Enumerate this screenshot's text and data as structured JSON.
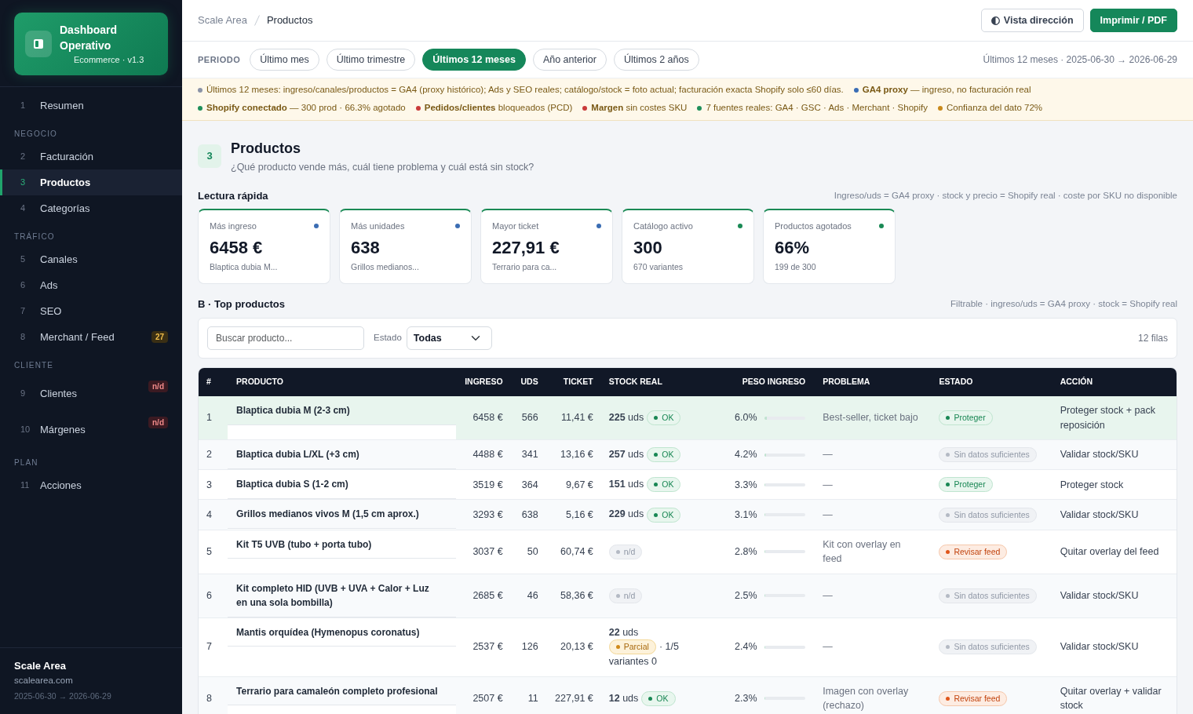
{
  "sidebar": {
    "brand": {
      "title": "Dashboard Operativo",
      "subtitle": "Ecommerce · v1.3"
    },
    "nav": [
      {
        "kind": "item",
        "number": "1",
        "label": "Resumen",
        "selected": false
      },
      {
        "kind": "heading",
        "label": "NEGOCIO"
      },
      {
        "kind": "item",
        "number": "2",
        "label": "Facturación",
        "selected": false
      },
      {
        "kind": "item",
        "number": "3",
        "label": "Productos",
        "selected": true
      },
      {
        "kind": "item",
        "number": "4",
        "label": "Categorías",
        "selected": false
      },
      {
        "kind": "heading",
        "label": "TRÁFICO"
      },
      {
        "kind": "item",
        "number": "5",
        "label": "Canales",
        "selected": false
      },
      {
        "kind": "item",
        "number": "6",
        "label": "Ads",
        "selected": false
      },
      {
        "kind": "item",
        "number": "7",
        "label": "SEO",
        "selected": false
      },
      {
        "kind": "item",
        "number": "8",
        "label": "Merchant / Feed",
        "selected": false,
        "badge": {
          "kind": "warning",
          "text": "27"
        }
      },
      {
        "kind": "heading",
        "label": "CLIENTE"
      },
      {
        "kind": "item",
        "number": "9",
        "label": "Clientes",
        "selected": false,
        "badge": {
          "kind": "danger",
          "text": "n/d"
        }
      },
      {
        "kind": "item",
        "number": "10",
        "label": "Márgenes",
        "selected": false,
        "badge": {
          "kind": "danger",
          "text": "n/d"
        }
      },
      {
        "kind": "heading",
        "label": "PLAN"
      },
      {
        "kind": "item",
        "number": "11",
        "label": "Acciones",
        "selected": false
      }
    ],
    "footer": {
      "name": "Scale Area",
      "site": "scalearea.com",
      "range": "2025-06-30 → 2026-06-29"
    }
  },
  "header": {
    "breadcrumb": [
      "Scale Area",
      "Productos"
    ],
    "buttons": [
      {
        "kind": "view",
        "label": "Vista dirección"
      },
      {
        "kind": "print",
        "label": "Imprimir / PDF"
      }
    ]
  },
  "period": {
    "label": "PERIODO",
    "options": [
      {
        "label": "Último mes",
        "selected": false
      },
      {
        "label": "Último trimestre",
        "selected": false
      },
      {
        "label": "Últimos 12 meses",
        "selected": true
      },
      {
        "label": "Año anterior",
        "selected": false
      },
      {
        "label": "Últimos 2 años",
        "selected": false
      }
    ],
    "range": "Últimos 12 meses · 2025-06-30 → 2026-06-29"
  },
  "notes": [
    [
      {
        "color": "#8b93a7",
        "text": "Últimos 12 meses: ingreso/canales/productos = GA4 (proxy histórico); Ads y SEO reales; catálogo/stock = foto actual; facturación exacta Shopify solo ≤60 días."
      },
      {
        "color": "#3a6db5",
        "text": "**GA4 proxy** — ingreso, no facturación real"
      }
    ],
    [
      {
        "color": "#1f8f5a",
        "text": "**Shopify conectado** — 300 prod · 66.3% agotado"
      },
      {
        "color": "#c93a3a",
        "text": "**Pedidos/clientes** bloqueados (PCD)"
      },
      {
        "color": "#c93a3a",
        "text": "**Margen** sin costes SKU"
      },
      {
        "color": "#1f8f5a",
        "text": "7 fuentes reales: GA4 · GSC · Ads · Merchant · Shopify"
      },
      {
        "color": "#c98a1c",
        "text": "Confianza del dato 72%"
      }
    ]
  ],
  "section": {
    "number": "3",
    "title": "Productos",
    "subtitle": "¿Qué producto vende más, cuál tiene problema y cuál está sin stock?"
  },
  "quick_read": {
    "title": "Lectura rápida",
    "note": "Ingreso/uds = GA4 proxy · stock y precio = Shopify real · coste por SKU no disponible",
    "cards": [
      {
        "label": "Más ingreso",
        "color": "#3b6db3",
        "value": "6458 €",
        "detail": "Blaptica dubia M..."
      },
      {
        "label": "Más unidades",
        "color": "#3b6db3",
        "value": "638",
        "detail": "Grillos medianos..."
      },
      {
        "label": "Mayor ticket",
        "color": "#3b6db3",
        "value": "227,91 €",
        "detail": "Terrario para ca..."
      },
      {
        "label": "Catálogo activo",
        "color": "#1a8a55",
        "value": "300",
        "detail": "670 variantes"
      },
      {
        "label": "Productos agotados",
        "color": "#1a8a55",
        "value": "66%",
        "detail": "199 de 300"
      }
    ]
  },
  "top_products": {
    "title": "B · Top productos",
    "note": "Filtrable · ingreso/uds = GA4 proxy · stock = Shopify real",
    "search": {
      "placeholder": "Buscar producto..."
    },
    "filter": {
      "label": "Estado",
      "value": "Todas"
    },
    "count": "12 filas",
    "table": {
      "columns": [
        "#",
        "PRODUCTO",
        "INGRESO",
        "UDS",
        "TICKET",
        "STOCK REAL",
        "PESO INGRESO",
        "PROBLEMA",
        "ESTADO",
        "ACCIÓN"
      ],
      "rows": [
        {
          "number": "1",
          "product": "Blaptica dubia M (2-3 cm)",
          "revenue": "6458 €",
          "units": "566",
          "ticket": "11,41 €",
          "stock": {
            "kind": "ok",
            "quantity": "**225** uds",
            "badge": "OK"
          },
          "share": "6.0%",
          "level": 0.06,
          "problem": "Best-seller, ticket bajo",
          "status": {
            "kind": "protect",
            "label": "Proteger"
          },
          "action": "Proteger stock + pack reposición",
          "selected": true
        },
        {
          "number": "2",
          "product": "Blaptica dubia L/XL (+3 cm)",
          "revenue": "4488 €",
          "units": "341",
          "ticket": "13,16 €",
          "stock": {
            "kind": "ok",
            "quantity": "**257** uds",
            "badge": "OK"
          },
          "share": "4.2%",
          "level": 0.042,
          "problem": "—",
          "status": {
            "kind": "none",
            "label": "Sin datos suficientes"
          },
          "action": "Validar stock/SKU",
          "selected": false
        },
        {
          "number": "3",
          "product": "Blaptica dubia S (1-2 cm)",
          "revenue": "3519 €",
          "units": "364",
          "ticket": "9,67 €",
          "stock": {
            "kind": "ok",
            "quantity": "**151** uds",
            "badge": "OK"
          },
          "share": "3.3%",
          "level": 0.033,
          "problem": "—",
          "status": {
            "kind": "protect",
            "label": "Proteger"
          },
          "action": "Proteger stock",
          "selected": false
        },
        {
          "number": "4",
          "product": "Grillos medianos vivos M (1,5 cm aprox.)",
          "revenue": "3293 €",
          "units": "638",
          "ticket": "5,16 €",
          "stock": {
            "kind": "ok",
            "quantity": "**229** uds",
            "badge": "OK"
          },
          "share": "3.1%",
          "level": 0.031,
          "problem": "—",
          "status": {
            "kind": "none",
            "label": "Sin datos suficientes"
          },
          "action": "Validar stock/SKU",
          "selected": false
        },
        {
          "number": "5",
          "product": "Kit T5 UVB (tubo + porta tubo)",
          "revenue": "3037 €",
          "units": "50",
          "ticket": "60,74 €",
          "stock": {
            "kind": "na",
            "badge": "n/d"
          },
          "share": "2.8%",
          "level": 0.028,
          "problem": "Kit con overlay en feed",
          "status": {
            "kind": "review",
            "label": "Revisar feed"
          },
          "action": "Quitar overlay del feed",
          "selected": false
        },
        {
          "number": "6",
          "product": "Kit completo HID (UVB + UVA + Calor + Luz en una sola bombilla)",
          "revenue": "2685 €",
          "units": "46",
          "ticket": "58,36 €",
          "stock": {
            "kind": "na",
            "badge": "n/d"
          },
          "share": "2.5%",
          "level": 0.025,
          "problem": "—",
          "status": {
            "kind": "none",
            "label": "Sin datos suficientes"
          },
          "action": "Validar stock/SKU",
          "selected": false
        },
        {
          "number": "7",
          "product": "Mantis orquídea (Hymenopus coronatus)",
          "revenue": "2537 €",
          "units": "126",
          "ticket": "20,13 €",
          "stock": {
            "kind": "partial",
            "quantity": "**22** uds",
            "badge": "Parcial",
            "details": [
              "· 1/5",
              "variantes 0"
            ]
          },
          "share": "2.4%",
          "level": 0.024,
          "problem": "—",
          "status": {
            "kind": "none",
            "label": "Sin datos suficientes"
          },
          "action": "Validar stock/SKU",
          "selected": false
        },
        {
          "number": "8",
          "product": "Terrario para camaleón completo profesional",
          "revenue": "2507 €",
          "units": "11",
          "ticket": "227,91 €",
          "stock": {
            "kind": "ok",
            "quantity": "**12** uds",
            "badge": "OK"
          },
          "share": "2.3%",
          "level": 0.023,
          "problem": "Imagen con overlay (rechazo)",
          "status": {
            "kind": "review",
            "label": "Revisar feed"
          },
          "action": "Quitar overlay + validar stock",
          "selected": false
        }
      ]
    }
  }
}
